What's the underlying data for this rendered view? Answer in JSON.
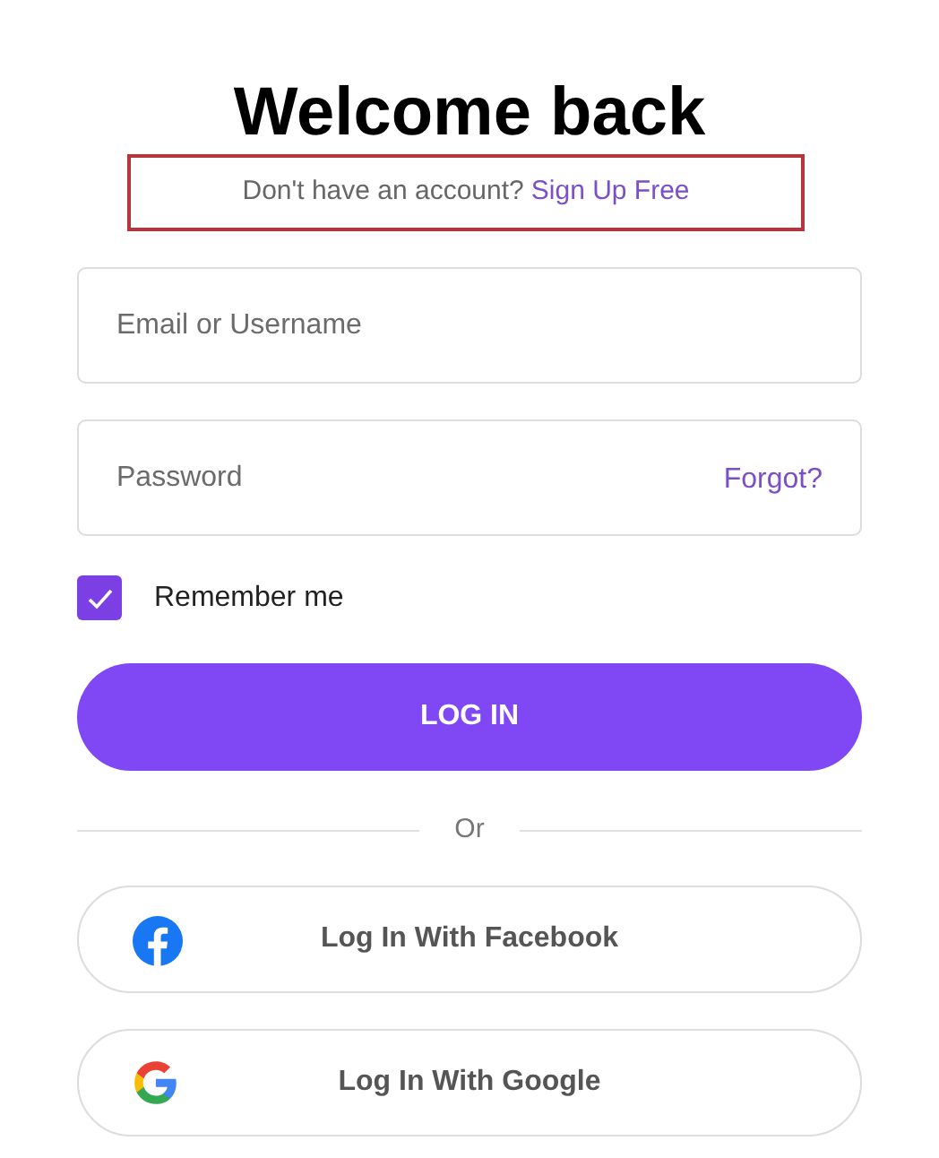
{
  "title": "Welcome back",
  "signup_prompt": {
    "text": "Don't have an account?",
    "link": "Sign Up Free",
    "highlighted": true
  },
  "fields": [
    {
      "placeholder": "Email or Username"
    },
    {
      "placeholder": "Password",
      "link": "Forgot?"
    }
  ],
  "remember": {
    "label": "Remember me",
    "checked": true
  },
  "login_button": "LOG IN",
  "divider": "Or",
  "social_buttons": [
    {
      "kind": "facebook",
      "label": "Log In With Facebook"
    },
    {
      "kind": "google",
      "label": "Log In With Google"
    }
  ]
}
